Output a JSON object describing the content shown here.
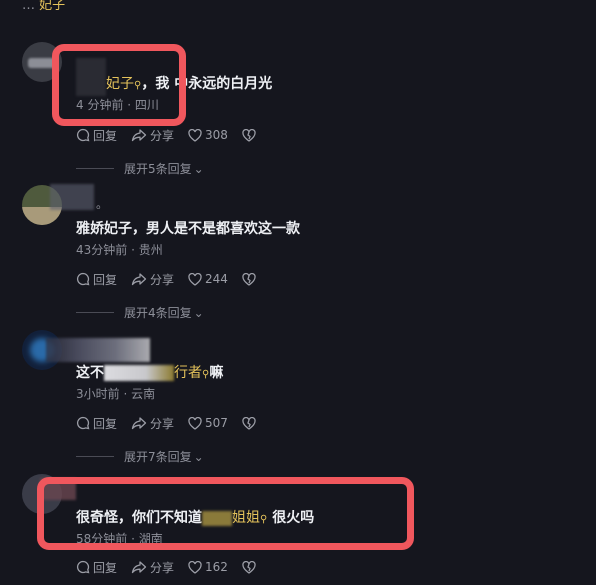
{
  "top_fragment": {
    "text": "…",
    "highlight": "妃子"
  },
  "comments": [
    {
      "name": "",
      "text_pre": "",
      "mention": "妃子",
      "text_post": "，我  中永远的白月光",
      "meta": "4 分钟前 · 四川",
      "reply": "回复",
      "share": "分享",
      "likes": "308",
      "expand": "展开5条回复"
    },
    {
      "name": "",
      "text_pre": "雅娇妃子，男人是不是都喜欢这一款",
      "mention": "",
      "text_post": "",
      "meta": "43分钟前 · 贵州",
      "reply": "回复",
      "share": "分享",
      "likes": "244",
      "expand": "展开4条回复"
    },
    {
      "name": "",
      "text_pre": "这不",
      "mention": "行者",
      "text_post": "嘛",
      "meta": "3小时前 · 云南",
      "reply": "回复",
      "share": "分享",
      "likes": "507",
      "expand": "展开7条回复"
    },
    {
      "name": "",
      "text_pre": "很奇怪，你们不知道",
      "mention": "姐姐",
      "text_post": "很火吗",
      "meta": "58分钟前 · 湖南",
      "reply": "回复",
      "share": "分享",
      "likes": "162",
      "expand": ""
    }
  ],
  "colors": {
    "background": "#15161e",
    "mention": "#e5c35b",
    "annotation_box": "#f0575d"
  }
}
